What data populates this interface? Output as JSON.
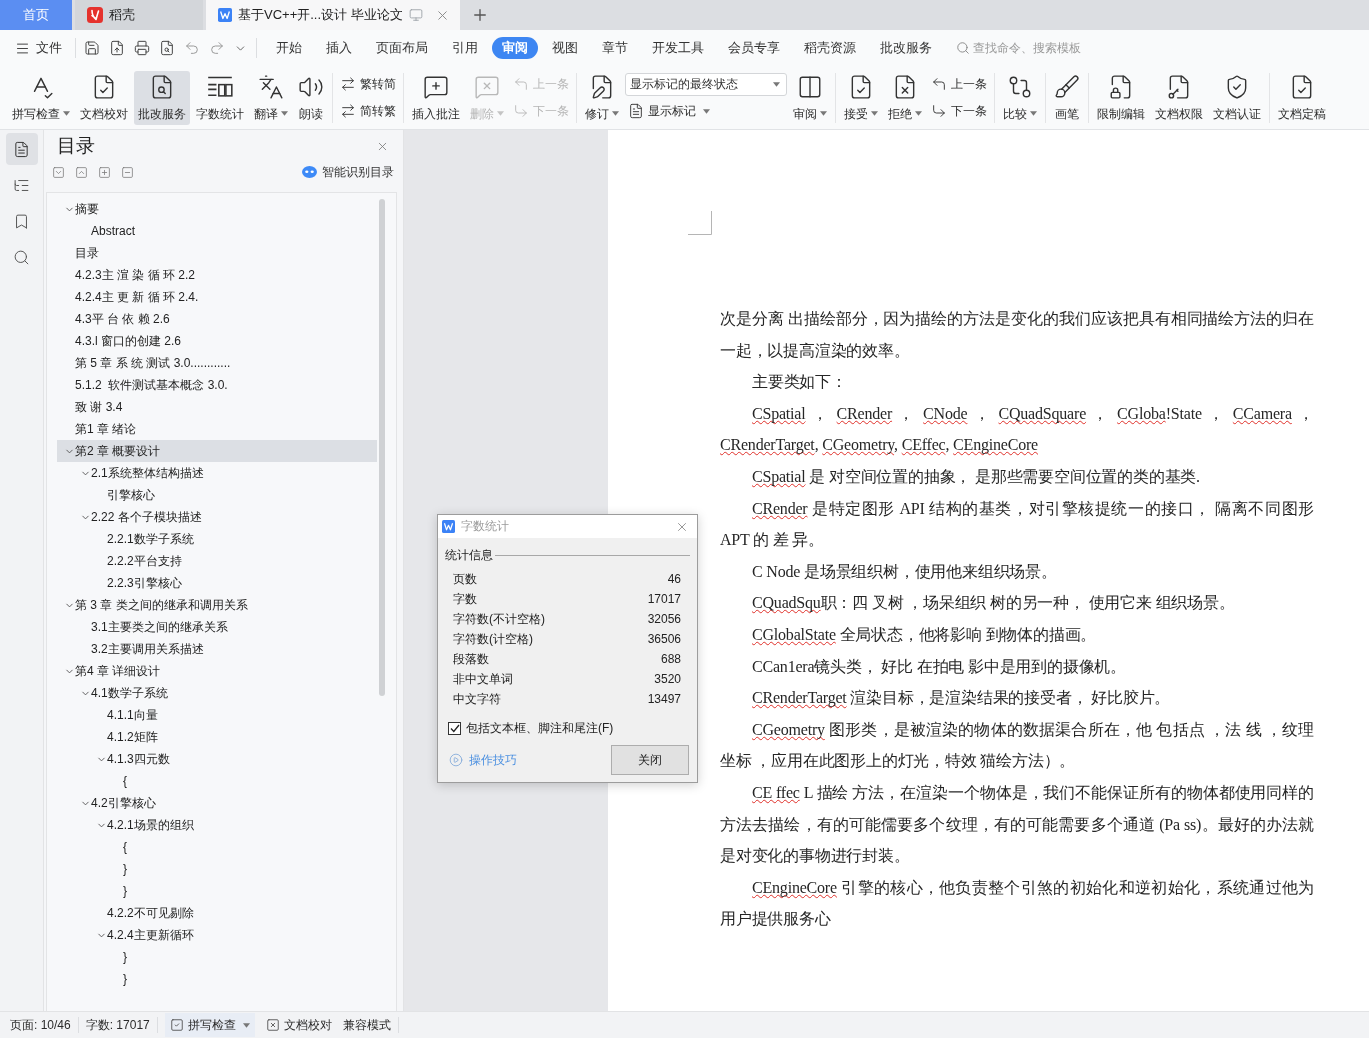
{
  "tab_bar": {
    "tabs": [
      {
        "kind": "home",
        "label": "首页",
        "selected": false
      },
      {
        "kind": "docer",
        "label": "稻壳",
        "selected": false
      },
      {
        "kind": "document",
        "label": "基于VC++开...设计 毕业论文",
        "selected": true
      }
    ]
  },
  "menu_bar": {
    "file_label": "文件",
    "menus": [
      {
        "label": "开始",
        "selected": false
      },
      {
        "label": "插入",
        "selected": false
      },
      {
        "label": "页面布局",
        "selected": false
      },
      {
        "label": "引用",
        "selected": false
      },
      {
        "label": "审阅",
        "selected": true
      },
      {
        "label": "视图",
        "selected": false
      },
      {
        "label": "章节",
        "selected": false
      },
      {
        "label": "开发工具",
        "selected": false
      },
      {
        "label": "会员专享",
        "selected": false
      },
      {
        "label": "稻壳资源",
        "selected": false
      },
      {
        "label": "批改服务",
        "selected": false
      }
    ],
    "search": {
      "placeholder": "查找命令、搜索模板"
    }
  },
  "ribbon": {
    "groups": [
      [
        {
          "kind": "large",
          "label": "拼写检查",
          "dropdown": true,
          "disabled": false,
          "active": false
        },
        {
          "kind": "large",
          "label": "文档校对",
          "dropdown": false,
          "disabled": false,
          "active": false
        },
        {
          "kind": "large",
          "label": "批改服务",
          "dropdown": false,
          "disabled": false,
          "active": true
        },
        {
          "kind": "large",
          "label": "字数统计",
          "dropdown": false,
          "disabled": false,
          "active": false
        },
        {
          "kind": "large",
          "label": "翻译",
          "dropdown": true,
          "disabled": false,
          "active": false
        },
        {
          "kind": "large",
          "label": "朗读",
          "dropdown": false,
          "disabled": false,
          "active": false
        }
      ],
      [
        {
          "kind": "stack",
          "items": [
            {
              "kind": "small",
              "label": "繁转简",
              "dropdown": false,
              "disabled": false
            },
            {
              "kind": "small",
              "label": "简转繁",
              "dropdown": false,
              "disabled": false
            }
          ]
        }
      ],
      [
        {
          "kind": "large",
          "label": "插入批注",
          "dropdown": false,
          "disabled": false,
          "active": false
        },
        {
          "kind": "large",
          "label": "删除",
          "dropdown": true,
          "disabled": true,
          "active": false
        },
        {
          "kind": "stack",
          "items": [
            {
              "kind": "small",
              "label": "上一条",
              "dropdown": false,
              "disabled": true
            },
            {
              "kind": "small",
              "label": "下一条",
              "dropdown": false,
              "disabled": true
            }
          ]
        }
      ],
      [
        {
          "kind": "large",
          "label": "修订",
          "dropdown": true,
          "disabled": false,
          "active": false
        },
        {
          "kind": "stack",
          "items": [
            {
              "kind": "select",
              "value": "显示标记的最终状态"
            },
            {
              "kind": "small",
              "label": "显示标记",
              "dropdown": true,
              "disabled": false
            }
          ]
        },
        {
          "kind": "large",
          "label": "审阅",
          "dropdown": true,
          "disabled": false,
          "active": false
        }
      ],
      [
        {
          "kind": "large",
          "label": "接受",
          "dropdown": true,
          "disabled": false,
          "active": false
        },
        {
          "kind": "large",
          "label": "拒绝",
          "dropdown": true,
          "disabled": false,
          "active": false
        },
        {
          "kind": "stack",
          "items": [
            {
              "kind": "small",
              "label": "上一条",
              "dropdown": false,
              "disabled": false
            },
            {
              "kind": "small",
              "label": "下一条",
              "dropdown": false,
              "disabled": false
            }
          ]
        }
      ],
      [
        {
          "kind": "large",
          "label": "比较",
          "dropdown": true,
          "disabled": false,
          "active": false
        }
      ],
      [
        {
          "kind": "large",
          "label": "画笔",
          "dropdown": false,
          "disabled": false,
          "active": false
        }
      ],
      [
        {
          "kind": "large",
          "label": "限制编辑",
          "dropdown": false,
          "disabled": false,
          "active": false
        },
        {
          "kind": "large",
          "label": "文档权限",
          "dropdown": false,
          "disabled": false,
          "active": false
        },
        {
          "kind": "large",
          "label": "文档认证",
          "dropdown": false,
          "disabled": false,
          "active": false
        }
      ],
      [
        {
          "kind": "large",
          "label": "文档定稿",
          "dropdown": false,
          "disabled": false,
          "active": false
        }
      ]
    ]
  },
  "nav_strip": [
    {
      "selected": true
    },
    {
      "selected": false
    },
    {
      "selected": false
    },
    {
      "selected": false
    }
  ],
  "toc_panel": {
    "title": "目录",
    "smart_button": "智能识别目录",
    "items": [
      {
        "label": "摘要",
        "selected": false,
        "expanded": true,
        "children": [
          {
            "label": "Abstract",
            "selected": false
          }
        ]
      },
      {
        "label": "目录",
        "selected": false
      },
      {
        "label": "4.2.3主 渲 染 循 环 2.2",
        "selected": false
      },
      {
        "label": "4.2.4主 更 新 循 环 2.4.",
        "selected": false
      },
      {
        "label": "4.3平 台 依 赖 2.6",
        "selected": false
      },
      {
        "label": "4.3.l 窗口的创建 2.6",
        "selected": false
      },
      {
        "label": "第 5 章 系 统 测试 3.0............",
        "selected": false
      },
      {
        "label": "5.1.2  软件测试基本概念 3.0.",
        "selected": false
      },
      {
        "label": "致 谢 3.4",
        "selected": false
      },
      {
        "label": "第1 章 绪论",
        "selected": false
      },
      {
        "label": "第2 章 概要设计",
        "selected": true,
        "expanded": true,
        "children": [
          {
            "label": "2.1系统整体结构描述",
            "selected": false,
            "expanded": true,
            "children": [
              {
                "label": "引擎核心",
                "selected": false
              }
            ]
          },
          {
            "label": "2.22 各个子模块描述",
            "selected": false,
            "expanded": true,
            "children": [
              {
                "label": "2.2.1数学子系统",
                "selected": false
              },
              {
                "label": "2.2.2平台支持",
                "selected": false
              },
              {
                "label": "2.2.3引擎核心",
                "selected": false
              }
            ]
          }
        ]
      },
      {
        "label": "第 3 章 类之间的继承和调用关系",
        "selected": false,
        "expanded": true,
        "children": [
          {
            "label": "3.1主要类之间的继承关系",
            "selected": false
          },
          {
            "label": "3.2主要调用关系描述",
            "selected": false
          }
        ]
      },
      {
        "label": "第4 章 详细设计",
        "selected": false,
        "expanded": true,
        "children": [
          {
            "label": "4.1数学子系统",
            "selected": false,
            "expanded": true,
            "children": [
              {
                "label": "4.1.1向量",
                "selected": false
              },
              {
                "label": "4.1.2矩阵",
                "selected": false
              },
              {
                "label": "4.1.3四元数",
                "selected": false,
                "expanded": true,
                "children": [
                  {
                    "label": "{",
                    "selected": false
                  }
                ]
              }
            ]
          },
          {
            "label": "4.2引擎核心",
            "selected": false,
            "expanded": true,
            "children": [
              {
                "label": "4.2.1场景的组织",
                "selected": false,
                "expanded": true,
                "children": [
                  {
                    "label": "{",
                    "selected": false
                  },
                  {
                    "label": "}",
                    "selected": false
                  },
                  {
                    "label": "}",
                    "selected": false
                  }
                ]
              },
              {
                "label": "4.2.2不可见剔除",
                "selected": false
              },
              {
                "label": "4.2.4主更新循环",
                "selected": false,
                "expanded": true,
                "children": [
                  {
                    "label": "}",
                    "selected": false
                  },
                  {
                    "label": "}",
                    "selected": false
                  }
                ]
              }
            ]
          }
        ]
      }
    ]
  },
  "document": {
    "paragraphs": [
      {
        "indent": false,
        "parts": [
          {
            "text": "次是分离 出描绘部分，因为描绘的方法是变化的我们应该把具有相同描绘方法的归在一起，以提高渲染的效率。",
            "misspelled": false
          }
        ]
      },
      {
        "indent": true,
        "parts": [
          {
            "text": "主要类如下：",
            "misspelled": false
          }
        ]
      },
      {
        "indent": true,
        "parts": [
          {
            "text": "CSpatial",
            "misspelled": true
          },
          {
            "text": " ， ",
            "misspelled": false
          },
          {
            "text": "CRender",
            "misspelled": true
          },
          {
            "text": " ， ",
            "misspelled": false
          },
          {
            "text": "CNode",
            "misspelled": true
          },
          {
            "text": " ， ",
            "misspelled": false
          },
          {
            "text": "CQuadSquare",
            "misspelled": true
          },
          {
            "text": " ， ",
            "misspelled": false
          },
          {
            "text": "CGloba",
            "misspelled": true
          },
          {
            "text": "!State ， ",
            "misspelled": false
          },
          {
            "text": "CCamera",
            "misspelled": true
          },
          {
            "text": " ，",
            "misspelled": false
          },
          {
            "text": "CRenderTarget",
            "misspelled": true
          },
          {
            "text": ", ",
            "misspelled": false
          },
          {
            "text": "CGeometry",
            "misspelled": true
          },
          {
            "text": ", ",
            "misspelled": false
          },
          {
            "text": "CEffec",
            "misspelled": true
          },
          {
            "text": ", ",
            "misspelled": false
          },
          {
            "text": "CEngineCore",
            "misspelled": true
          }
        ]
      },
      {
        "indent": true,
        "parts": [
          {
            "text": "CSpatial",
            "misspelled": true
          },
          {
            "text": " 是 对空间位置的抽象， 是那些需要空间位置的类的基类.",
            "misspelled": false
          }
        ]
      },
      {
        "indent": true,
        "parts": [
          {
            "text": "CRender",
            "misspelled": true
          },
          {
            "text": " 是特定图形 API 结构的基类，对引擎核提统一的接口， 隔离不同图形APT 的 差 异。",
            "misspelled": false
          }
        ]
      },
      {
        "indent": true,
        "parts": [
          {
            "text": "C Node 是场景组织树，使用他来组织场景。",
            "misspelled": false
          }
        ]
      },
      {
        "indent": true,
        "parts": [
          {
            "text": "CQuadSqu",
            "misspelled": true
          },
          {
            "text": "职：四 叉树 ，场呆组织 树的另一种， 使用它来 组织场景。",
            "misspelled": false
          }
        ]
      },
      {
        "indent": true,
        "parts": [
          {
            "text": "CGlobalState",
            "misspelled": true
          },
          {
            "text": " 全局状态，他将影响 到物体的描画。",
            "misspelled": false
          }
        ]
      },
      {
        "indent": true,
        "parts": [
          {
            "text": "CCan1era镜头类， 好比 在拍电 影中是用到的摄像机。",
            "misspelled": false
          }
        ]
      },
      {
        "indent": true,
        "parts": [
          {
            "text": "CRenderTarget",
            "misspelled": true
          },
          {
            "text": " 渲染目标，是渲染结果的接受者， 好比胶片。",
            "misspelled": false
          }
        ]
      },
      {
        "indent": true,
        "parts": [
          {
            "text": "CGeometry",
            "misspelled": true
          },
          {
            "text": " 图形类，是被渲染的物体的数据渠合所在，他 包括点 ，法 线 ，纹理坐标 ，应用在此图形上的灯光，特效 猫绘方法）。",
            "misspelled": false
          }
        ]
      },
      {
        "indent": true,
        "parts": [
          {
            "text": "CE ffec",
            "misspelled": true
          },
          {
            "text": " L 描绘 方法，在渲染一个物体是，我们不能保证所有的物体都使用同样的方法去描绘，有的可能儒要多个纹理，有的可能需要多个通道 (Pa ss)。最好的办法就是对变化的事物进行封装。",
            "misspelled": false
          }
        ]
      },
      {
        "indent": true,
        "parts": [
          {
            "text": "CEngineCore",
            "misspelled": true
          },
          {
            "text": " 引擎的核心，他负责整个引煞的初始化和逆初始化，系统通过他为用户提供服务心",
            "misspelled": false
          }
        ]
      }
    ]
  },
  "word_count_dialog": {
    "title": "字数统计",
    "section": "统计信息",
    "stats": [
      {
        "label": "页数",
        "value": "46"
      },
      {
        "label": "字数",
        "value": "17017"
      },
      {
        "label": "字符数(不计空格)",
        "value": "32056"
      },
      {
        "label": "字符数(计空格)",
        "value": "36506"
      },
      {
        "label": "段落数",
        "value": "688"
      },
      {
        "label": "非中文单词",
        "value": "3520"
      },
      {
        "label": "中文字符",
        "value": "13497"
      }
    ],
    "include_notes": {
      "label": "包括文本框、脚注和尾注(F)",
      "checked": true
    },
    "tips_link": "操作技巧",
    "close_button": "关闭"
  },
  "status_bar": {
    "items": [
      {
        "kind": "text",
        "label": "页面: 10/46"
      },
      {
        "kind": "text",
        "label": "字数: 17017"
      },
      {
        "kind": "button",
        "label": "拼写检查",
        "dropdown": true,
        "active": true
      },
      {
        "kind": "button",
        "label": "文档校对",
        "dropdown": false,
        "active": false
      },
      {
        "kind": "text",
        "label": "兼容模式"
      }
    ]
  }
}
